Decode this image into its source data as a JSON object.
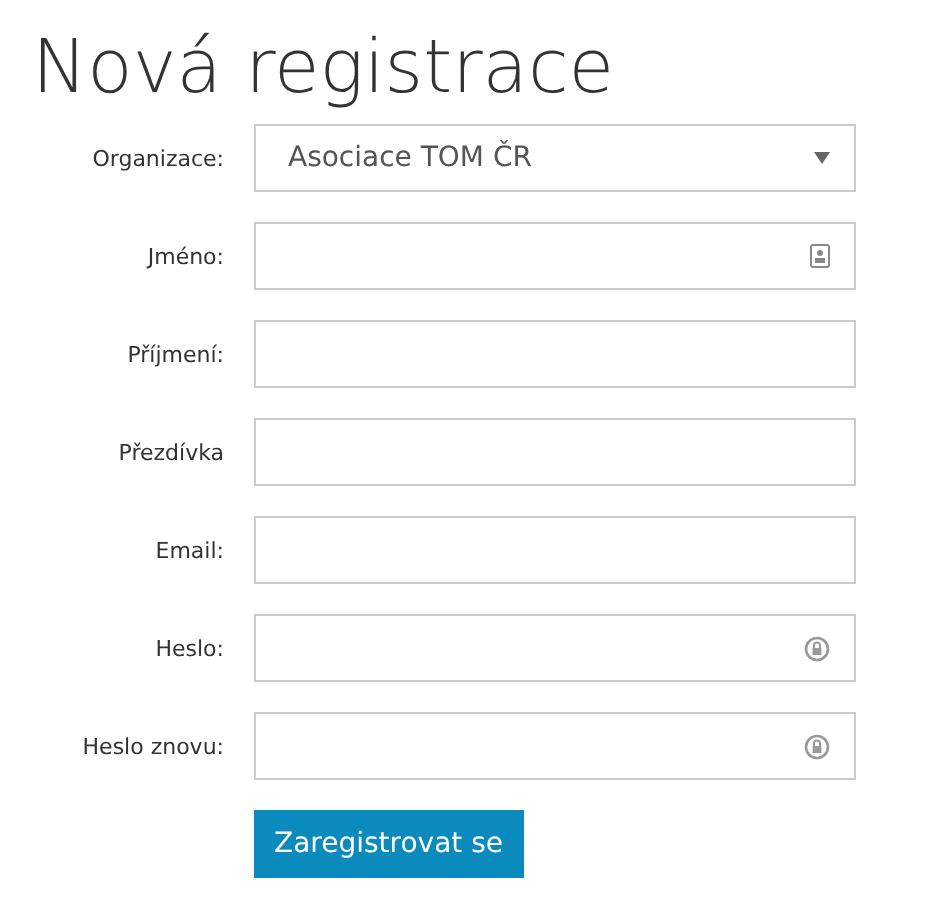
{
  "title": "Nová registrace",
  "fields": [
    {
      "label": "Organizace:",
      "kind": "select",
      "value": "Asociace TOM ČR"
    },
    {
      "label": "Jméno:",
      "kind": "contact"
    },
    {
      "label": "Příjmení:",
      "kind": "text"
    },
    {
      "label": "Přezdívka",
      "kind": "text"
    },
    {
      "label": "Email:",
      "kind": "text"
    },
    {
      "label": "Heslo:",
      "kind": "password"
    },
    {
      "label": "Heslo znovu:",
      "kind": "password"
    }
  ],
  "submit": "Zaregistrovat se"
}
